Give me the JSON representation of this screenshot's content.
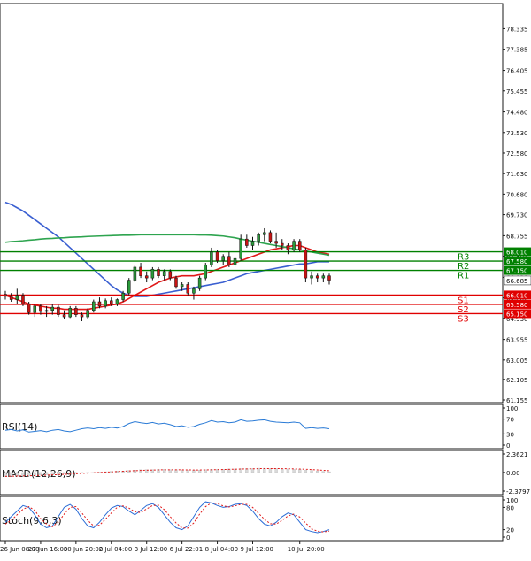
{
  "chart_data": [
    {
      "type": "candlestick",
      "title": "",
      "price_axis": {
        "ylim": [
          61.155,
          79.335
        ],
        "ticks": [
          "78.335",
          "77.385",
          "76.405",
          "75.455",
          "74.480",
          "73.530",
          "72.580",
          "71.630",
          "70.680",
          "69.730",
          "68.755",
          "67.805",
          "66.830",
          "65.880",
          "64.930",
          "63.955",
          "63.005",
          "62.105",
          "61.155"
        ]
      },
      "x_axis_labels": [
        "26 Jun 08:00",
        "27 Jun 16:00",
        "30 Jun 20:00",
        "2 Jul 04:00",
        "3 Jul 12:00",
        "6 Jul 22:01",
        "8 Jul 04:00",
        "9 Jul 12:00",
        "10 Jul 20:00"
      ],
      "levels": [
        {
          "name": "R3",
          "value": 68.01,
          "label": "68.010",
          "color": "#008000"
        },
        {
          "name": "R2",
          "value": 67.58,
          "label": "67.580",
          "color": "#008000"
        },
        {
          "name": "R1",
          "value": 67.15,
          "label": "67.150",
          "color": "#008000"
        },
        {
          "name": "S1",
          "value": 66.01,
          "label": "66.010",
          "color": "#e00000"
        },
        {
          "name": "S2",
          "value": 65.58,
          "label": "65.580",
          "color": "#e00000"
        },
        {
          "name": "S3",
          "value": 65.15,
          "label": "65.150",
          "color": "#e00000"
        }
      ],
      "current_price": {
        "value": 66.685,
        "label": "66.685"
      },
      "candles": [
        [
          66.05,
          66.2,
          65.8,
          65.95
        ],
        [
          65.95,
          66.1,
          65.7,
          65.8
        ],
        [
          65.8,
          66.3,
          65.6,
          66.0
        ],
        [
          66.0,
          66.1,
          65.5,
          65.6
        ],
        [
          65.6,
          65.7,
          65.1,
          65.2
        ],
        [
          65.2,
          65.6,
          65.0,
          65.5
        ],
        [
          65.5,
          65.6,
          65.1,
          65.25
        ],
        [
          65.25,
          65.5,
          65.0,
          65.3
        ],
        [
          65.3,
          65.6,
          65.1,
          65.45
        ],
        [
          65.45,
          65.55,
          65.0,
          65.1
        ],
        [
          65.1,
          65.3,
          64.9,
          65.0
        ],
        [
          65.0,
          65.5,
          64.95,
          65.4
        ],
        [
          65.4,
          65.5,
          65.0,
          65.1
        ],
        [
          65.1,
          65.2,
          64.8,
          65.0
        ],
        [
          65.0,
          65.4,
          64.9,
          65.3
        ],
        [
          65.3,
          65.8,
          65.2,
          65.7
        ],
        [
          65.7,
          65.9,
          65.4,
          65.5
        ],
        [
          65.5,
          65.85,
          65.4,
          65.75
        ],
        [
          65.75,
          65.9,
          65.5,
          65.6
        ],
        [
          65.6,
          65.85,
          65.5,
          65.8
        ],
        [
          65.8,
          66.2,
          65.7,
          66.1
        ],
        [
          66.1,
          66.8,
          66.0,
          66.7
        ],
        [
          66.7,
          67.4,
          66.6,
          67.3
        ],
        [
          67.3,
          67.5,
          66.8,
          66.9
        ],
        [
          66.9,
          67.1,
          66.6,
          66.8
        ],
        [
          66.8,
          67.3,
          66.7,
          67.2
        ],
        [
          67.2,
          67.3,
          66.8,
          66.9
        ],
        [
          66.9,
          67.2,
          66.7,
          67.1
        ],
        [
          67.1,
          67.2,
          66.7,
          66.8
        ],
        [
          66.8,
          66.9,
          66.3,
          66.4
        ],
        [
          66.4,
          66.6,
          66.2,
          66.5
        ],
        [
          66.5,
          66.6,
          66.0,
          66.1
        ],
        [
          66.1,
          66.4,
          65.8,
          66.3
        ],
        [
          66.3,
          66.9,
          66.2,
          66.8
        ],
        [
          66.8,
          67.5,
          66.7,
          67.4
        ],
        [
          67.4,
          68.2,
          67.3,
          68.0
        ],
        [
          68.0,
          68.1,
          67.5,
          67.6
        ],
        [
          67.6,
          67.9,
          67.4,
          67.8
        ],
        [
          67.8,
          68.0,
          67.3,
          67.4
        ],
        [
          67.4,
          67.8,
          67.3,
          67.7
        ],
        [
          67.7,
          68.8,
          67.6,
          68.6
        ],
        [
          68.6,
          68.8,
          68.2,
          68.3
        ],
        [
          68.3,
          68.7,
          68.1,
          68.5
        ],
        [
          68.5,
          68.9,
          68.3,
          68.8
        ],
        [
          68.8,
          69.1,
          68.5,
          68.9
        ],
        [
          68.9,
          69.0,
          68.4,
          68.5
        ],
        [
          68.5,
          68.9,
          68.2,
          68.4
        ],
        [
          68.4,
          68.6,
          68.1,
          68.3
        ],
        [
          68.3,
          68.4,
          67.9,
          68.1
        ],
        [
          68.1,
          68.6,
          68.0,
          68.5
        ],
        [
          68.5,
          68.6,
          68.0,
          68.1
        ],
        [
          68.1,
          68.2,
          66.6,
          66.8
        ],
        [
          66.8,
          67.1,
          66.5,
          66.9
        ],
        [
          66.9,
          67.0,
          66.6,
          66.8
        ],
        [
          66.8,
          67.0,
          66.6,
          66.9
        ],
        [
          66.9,
          67.0,
          66.5,
          66.7
        ]
      ],
      "ma_series": [
        {
          "color": "#3a5fd1",
          "values": [
            70.3,
            70.2,
            70.05,
            69.9,
            69.7,
            69.5,
            69.3,
            69.1,
            68.9,
            68.7,
            68.45,
            68.2,
            67.95,
            67.7,
            67.45,
            67.2,
            66.95,
            66.7,
            66.45,
            66.25,
            66.1,
            66.0,
            65.95,
            65.95,
            65.95,
            66.0,
            66.05,
            66.1,
            66.15,
            66.2,
            66.25,
            66.3,
            66.35,
            66.4,
            66.45,
            66.5,
            66.55,
            66.6,
            66.7,
            66.8,
            66.9,
            67.0,
            67.05,
            67.1,
            67.15,
            67.2,
            67.25,
            67.3,
            67.35,
            67.4,
            67.45,
            67.45,
            67.5,
            67.55,
            67.55,
            67.55
          ]
        },
        {
          "color": "#e01818",
          "values": [
            66.0,
            65.9,
            65.8,
            65.7,
            65.6,
            65.55,
            65.5,
            65.45,
            65.4,
            65.4,
            65.35,
            65.35,
            65.35,
            65.35,
            65.35,
            65.4,
            65.45,
            65.5,
            65.55,
            65.6,
            65.7,
            65.85,
            66.0,
            66.15,
            66.3,
            66.45,
            66.6,
            66.7,
            66.8,
            66.85,
            66.9,
            66.9,
            66.9,
            66.95,
            67.0,
            67.1,
            67.2,
            67.3,
            67.4,
            67.5,
            67.6,
            67.7,
            67.8,
            67.9,
            68.0,
            68.1,
            68.15,
            68.2,
            68.25,
            68.3,
            68.3,
            68.2,
            68.1,
            68.0,
            67.95,
            67.9
          ]
        },
        {
          "color": "#2ea44f",
          "values": [
            68.45,
            68.48,
            68.5,
            68.52,
            68.55,
            68.57,
            68.6,
            68.62,
            68.63,
            68.65,
            68.66,
            68.68,
            68.69,
            68.7,
            68.72,
            68.73,
            68.74,
            68.75,
            68.76,
            68.77,
            68.78,
            68.78,
            68.79,
            68.8,
            68.8,
            68.8,
            68.8,
            68.8,
            68.8,
            68.8,
            68.8,
            68.8,
            68.8,
            68.79,
            68.79,
            68.78,
            68.76,
            68.74,
            68.7,
            68.66,
            68.6,
            68.55,
            68.5,
            68.45,
            68.4,
            68.35,
            68.3,
            68.25,
            68.2,
            68.15,
            68.1,
            68.05,
            68.0,
            67.95,
            67.9,
            67.85
          ]
        }
      ]
    },
    {
      "type": "line",
      "title": "RSI(14)",
      "ylim": [
        0,
        100
      ],
      "ticks": [
        "100",
        "70",
        "30",
        "0"
      ],
      "series": [
        {
          "values": [
            40,
            42,
            38,
            41,
            35,
            37,
            39,
            36,
            40,
            42,
            38,
            36,
            40,
            44,
            46,
            44,
            47,
            45,
            48,
            46,
            50,
            58,
            63,
            60,
            58,
            61,
            57,
            59,
            55,
            50,
            52,
            48,
            50,
            56,
            60,
            66,
            62,
            63,
            60,
            62,
            68,
            64,
            65,
            67,
            68,
            64,
            62,
            61,
            60,
            62,
            60,
            45,
            47,
            45,
            46,
            44
          ]
        }
      ]
    },
    {
      "type": "macd",
      "title": "MACD(12,26,9)",
      "ylim": [
        -2.3797,
        2.3621
      ],
      "ticks": [
        "2.3621",
        "0.00",
        "-2.3797"
      ],
      "histogram": [
        -0.55,
        -0.5,
        -0.5,
        -0.45,
        -0.45,
        -0.4,
        -0.35,
        -0.3,
        -0.3,
        -0.25,
        -0.2,
        -0.15,
        -0.1,
        -0.1,
        -0.05,
        0,
        0.05,
        0.1,
        0.15,
        0.2,
        0.2,
        0.25,
        0.3,
        0.35,
        0.35,
        0.35,
        0.4,
        0.4,
        0.35,
        0.35,
        0.3,
        0.3,
        0.3,
        0.3,
        0.35,
        0.4,
        0.4,
        0.4,
        0.45,
        0.45,
        0.5,
        0.5,
        0.5,
        0.55,
        0.55,
        0.5,
        0.5,
        0.45,
        0.45,
        0.4,
        0.4,
        0.3,
        0.25,
        0.2,
        0.15,
        0.1
      ],
      "signal": [
        -0.5,
        -0.48,
        -0.46,
        -0.44,
        -0.42,
        -0.4,
        -0.37,
        -0.34,
        -0.31,
        -0.28,
        -0.24,
        -0.2,
        -0.16,
        -0.12,
        -0.08,
        -0.04,
        0.0,
        0.04,
        0.08,
        0.12,
        0.16,
        0.2,
        0.23,
        0.26,
        0.29,
        0.31,
        0.33,
        0.35,
        0.35,
        0.35,
        0.34,
        0.33,
        0.32,
        0.32,
        0.33,
        0.35,
        0.37,
        0.38,
        0.4,
        0.42,
        0.44,
        0.46,
        0.47,
        0.49,
        0.5,
        0.5,
        0.5,
        0.49,
        0.48,
        0.46,
        0.44,
        0.41,
        0.37,
        0.33,
        0.28,
        0.23
      ]
    },
    {
      "type": "line",
      "title": "Stoch(9,6,3)",
      "ylim": [
        0,
        100
      ],
      "ticks": [
        "100",
        "80",
        "20",
        "0"
      ],
      "series": [
        {
          "color": "#2b6cd6",
          "values": [
            40,
            55,
            70,
            85,
            80,
            60,
            35,
            25,
            30,
            55,
            80,
            88,
            75,
            50,
            30,
            25,
            40,
            60,
            78,
            85,
            82,
            70,
            60,
            72,
            85,
            90,
            80,
            60,
            40,
            25,
            20,
            30,
            55,
            80,
            95,
            92,
            85,
            80,
            82,
            88,
            90,
            85,
            70,
            50,
            35,
            30,
            40,
            55,
            65,
            60,
            40,
            20,
            15,
            12,
            15,
            20
          ]
        },
        {
          "color": "#e01818",
          "dashed": true,
          "values": [
            35,
            45,
            60,
            75,
            82,
            72,
            50,
            35,
            28,
            40,
            62,
            80,
            82,
            65,
            45,
            30,
            32,
            48,
            65,
            80,
            84,
            78,
            68,
            66,
            76,
            85,
            86,
            74,
            55,
            38,
            25,
            24,
            38,
            62,
            82,
            92,
            90,
            84,
            81,
            84,
            88,
            88,
            80,
            64,
            48,
            36,
            35,
            45,
            57,
            62,
            54,
            38,
            22,
            16,
            14,
            16
          ]
        }
      ]
    }
  ]
}
